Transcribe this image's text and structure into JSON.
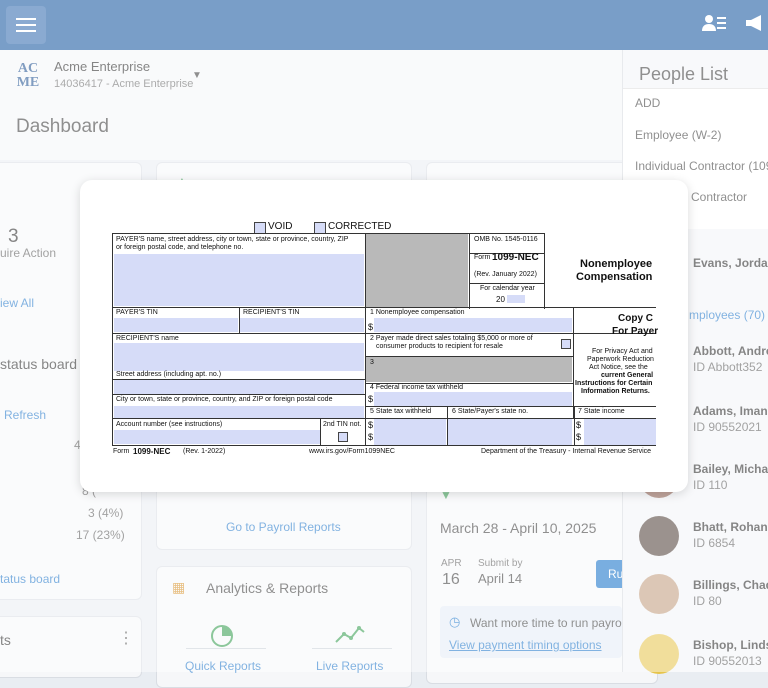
{
  "topbar": {
    "menu_icon": "hamburger-menu-icon",
    "people_icon": "people-icon",
    "megaphone_icon": "megaphone-icon"
  },
  "company": {
    "logo_line1": "AC",
    "logo_line2": "ME",
    "name": "Acme Enterprise",
    "sub": "14036417 - Acme Enterprise"
  },
  "page": {
    "title": "Dashboard"
  },
  "left_cards": {
    "count": "3",
    "count_label": "uire Action",
    "view_all": "iew All",
    "status_board_title": "status board",
    "refresh": "Refresh",
    "stat_4": "4",
    "stat_pct_hidden": "8 (",
    "stat_a": "3 (4%)",
    "stat_b": "17 (23%)",
    "status_board_link": "tatus board",
    "bottom_title": "ts"
  },
  "mid_cards": {
    "payroll_link": "Go to Payroll Reports",
    "analytics_title": "Analytics & Reports",
    "quick_reports": "Quick Reports",
    "live_reports": "Live Reports"
  },
  "right_cards": {
    "period": "March 28 - April 10, 2025",
    "submit_month": "APR",
    "submit_day": "16",
    "submit_by_label": "Submit by",
    "submit_by_date": "April 14",
    "run_button": "Ru",
    "timing_text": "Want more time to run payroll",
    "timing_link": "View payment timing options"
  },
  "people_list": {
    "title": "People List",
    "menu": [
      "ADD",
      "Employee (W-2)",
      "Individual Contractor (109",
      "Contractor"
    ],
    "first_partial": "Evans, Jorda",
    "employees_link": "mployees (70)",
    "people": [
      {
        "name": "Abbott, Andre",
        "id": "ID Abbott352"
      },
      {
        "name": "Adams, Imani",
        "id": "ID 90552021"
      },
      {
        "name": "Bailey, Micha",
        "id": "ID 110"
      },
      {
        "name": "Bhatt, Rohan",
        "id": "ID 6854"
      },
      {
        "name": "Billings, Chad",
        "id": "ID 80"
      },
      {
        "name": "Bishop, Linds",
        "id": "ID 90552013"
      }
    ]
  },
  "form": {
    "void": "VOID",
    "corrected": "CORRECTED",
    "payer_name_label": "PAYER'S name, street address, city or town, state or province, country, ZIP",
    "payer_name_label2": "or foreign postal code, and telephone no.",
    "omb": "OMB No. 1545-0116",
    "form_label": "Form",
    "form_name": "1099-NEC",
    "rev": "(Rev. January 2022)",
    "cal_year": "For calendar year",
    "year_prefix": "20",
    "title1": "Nonemployee",
    "title2": "Compensation",
    "payer_tin": "PAYER'S TIN",
    "recipient_tin": "RECIPIENT'S TIN",
    "box1": "1 Nonemployee compensation",
    "dollar": "$",
    "copy_c": "Copy C",
    "for_payer": "For Payer",
    "recipient_name": "RECIPIENT'S name",
    "box2_a": "2 Payer made direct sales totaling $5,000 or more of",
    "box2_b": "consumer products to recipient for resale",
    "privacy1": "For Privacy Act and",
    "privacy2": "Paperwork Reduction",
    "privacy3": "Act Notice, see the",
    "privacy4": "current General",
    "privacy5": "Instructions for Certain",
    "privacy6": "Information Returns.",
    "box3": "3",
    "street": "Street address (including apt. no.)",
    "box4": "4 Federal income tax withheld",
    "city": "City or town, state or province, country, and ZIP or foreign postal code",
    "box5": "5 State tax withheld",
    "box6": "6 State/Payer's state no.",
    "box7": "7 State income",
    "account": "Account number (see instructions)",
    "tin2": "2nd TIN not.",
    "footer_form": "Form",
    "footer_name": "1099-NEC",
    "footer_rev": "(Rev. 1-2022)",
    "footer_url": "www.irs.gov/Form1099NEC",
    "footer_dept": "Department of the Treasury - Internal Revenue Service"
  }
}
